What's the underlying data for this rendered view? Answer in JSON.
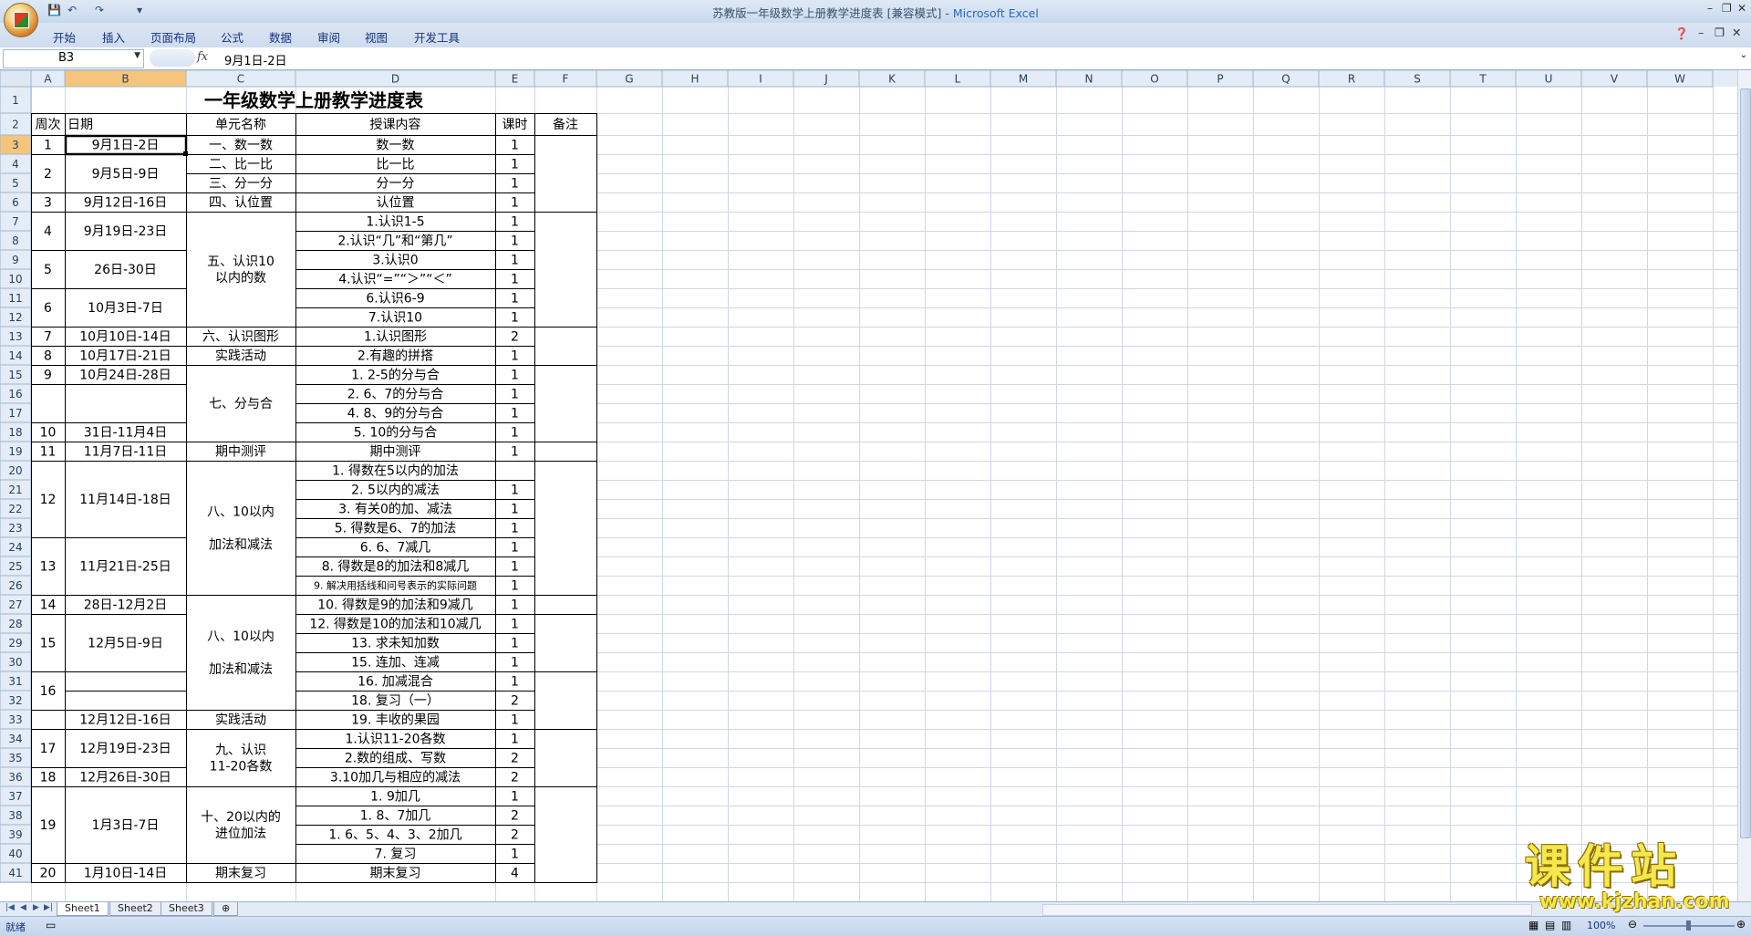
{
  "window": {
    "title_doc": "苏教版一年级数学上册教学进度表  [兼容模式] - ",
    "title_app": "Microsoft Excel"
  },
  "ribbon_tabs": [
    "开始",
    "插入",
    "页面布局",
    "公式",
    "数据",
    "审阅",
    "视图",
    "开发工具"
  ],
  "formula_bar": {
    "name_box": "B3",
    "fx": "fx",
    "value": "9月1日-2日"
  },
  "columns": [
    "A",
    "B",
    "C",
    "D",
    "E",
    "F",
    "G",
    "H",
    "I",
    "J",
    "K",
    "L",
    "M",
    "N",
    "O",
    "P",
    "Q",
    "R",
    "S",
    "T",
    "U",
    "V",
    "W"
  ],
  "selected": {
    "col": "B",
    "row": 3
  },
  "sheet": {
    "title": "一年级数学上册教学进度表",
    "headers": [
      "周次",
      "日期",
      "单元名称",
      "授课内容",
      "课时",
      "备注"
    ],
    "rows": [
      {
        "r": 3,
        "d": "数一数",
        "e": "1"
      },
      {
        "r": 4,
        "d": "比一比",
        "e": "1"
      },
      {
        "r": 5,
        "d": "分一分",
        "e": "1"
      },
      {
        "r": 6,
        "d": "认位置",
        "e": "1"
      },
      {
        "r": 7,
        "d": "1.认识1-5",
        "e": "1"
      },
      {
        "r": 8,
        "d": "2.认识“几”和“第几”",
        "e": "1"
      },
      {
        "r": 9,
        "d": "3.认识0",
        "e": "1"
      },
      {
        "r": 10,
        "d": "4.认识“=”“＞”“＜”",
        "e": "1"
      },
      {
        "r": 11,
        "d": "6.认识6-9",
        "e": "1"
      },
      {
        "r": 12,
        "d": "7.认识10",
        "e": "1"
      },
      {
        "r": 13,
        "d": "1.认识图形",
        "e": "2"
      },
      {
        "r": 14,
        "d": "2.有趣的拼搭",
        "e": "1"
      },
      {
        "r": 15,
        "d": "1. 2-5的分与合",
        "e": "1"
      },
      {
        "r": 16,
        "d": "2. 6、7的分与合",
        "e": "1"
      },
      {
        "r": 17,
        "d": "4. 8、9的分与合",
        "e": "1"
      },
      {
        "r": 18,
        "d": "5. 10的分与合",
        "e": "1"
      },
      {
        "r": 19,
        "d": "期中测评",
        "e": "1"
      },
      {
        "r": 20,
        "d": "1. 得数在5以内的加法",
        "e": ""
      },
      {
        "r": 21,
        "d": "2. 5以内的减法",
        "e": "1"
      },
      {
        "r": 22,
        "d": "3. 有关0的加、减法",
        "e": "1"
      },
      {
        "r": 23,
        "d": "5. 得数是6、7的加法",
        "e": "1"
      },
      {
        "r": 24,
        "d": "6. 6、7减几",
        "e": "1"
      },
      {
        "r": 25,
        "d": "8. 得数是8的加法和8减几",
        "e": "1"
      },
      {
        "r": 26,
        "d": "9. 解决用括线和问号表示的实际问题",
        "e": "1",
        "small": true
      },
      {
        "r": 27,
        "d": "10. 得数是9的加法和9减几",
        "e": "1"
      },
      {
        "r": 28,
        "d": "12. 得数是10的加法和10减几",
        "e": "1"
      },
      {
        "r": 29,
        "d": "13. 求未知加数",
        "e": "1"
      },
      {
        "r": 30,
        "d": "15. 连加、连减",
        "e": "1"
      },
      {
        "r": 31,
        "d": "16. 加减混合",
        "e": "1"
      },
      {
        "r": 32,
        "d": "18. 复习（一）",
        "e": "2"
      },
      {
        "r": 33,
        "d": "19. 丰收的果园",
        "e": "1"
      },
      {
        "r": 34,
        "d": "1.认识11-20各数",
        "e": "1"
      },
      {
        "r": 35,
        "d": "2.数的组成、写数",
        "e": "2"
      },
      {
        "r": 36,
        "d": "3.10加几与相应的减法",
        "e": "2"
      },
      {
        "r": 37,
        "d": "1. 9加几",
        "e": "1"
      },
      {
        "r": 38,
        "d": "1. 8、7加几",
        "e": "2"
      },
      {
        "r": 39,
        "d": "1. 6、5、4、3、2加几",
        "e": "2"
      },
      {
        "r": 40,
        "d": "7. 复习",
        "e": "1"
      },
      {
        "r": 41,
        "d": "期末复习",
        "e": "4"
      }
    ],
    "merges": [
      {
        "c": "A",
        "r1": 3,
        "r2": 3,
        "text": "1"
      },
      {
        "c": "A",
        "r1": 4,
        "r2": 5,
        "text": "2"
      },
      {
        "c": "A",
        "r1": 6,
        "r2": 6,
        "text": "3"
      },
      {
        "c": "A",
        "r1": 7,
        "r2": 8,
        "text": "4"
      },
      {
        "c": "A",
        "r1": 9,
        "r2": 10,
        "text": "5"
      },
      {
        "c": "A",
        "r1": 11,
        "r2": 12,
        "text": "6"
      },
      {
        "c": "A",
        "r1": 13,
        "r2": 13,
        "text": "7"
      },
      {
        "c": "A",
        "r1": 14,
        "r2": 14,
        "text": "8"
      },
      {
        "c": "A",
        "r1": 15,
        "r2": 15,
        "text": "9"
      },
      {
        "c": "A",
        "r1": 16,
        "r2": 17,
        "text": ""
      },
      {
        "c": "A",
        "r1": 18,
        "r2": 18,
        "text": "10"
      },
      {
        "c": "A",
        "r1": 19,
        "r2": 19,
        "text": "11"
      },
      {
        "c": "A",
        "r1": 20,
        "r2": 23,
        "text": "12"
      },
      {
        "c": "A",
        "r1": 24,
        "r2": 26,
        "text": "13"
      },
      {
        "c": "A",
        "r1": 27,
        "r2": 27,
        "text": "14"
      },
      {
        "c": "A",
        "r1": 28,
        "r2": 30,
        "text": "15"
      },
      {
        "c": "A",
        "r1": 31,
        "r2": 32,
        "text": "16"
      },
      {
        "c": "A",
        "r1": 33,
        "r2": 33,
        "text": ""
      },
      {
        "c": "A",
        "r1": 34,
        "r2": 35,
        "text": "17"
      },
      {
        "c": "A",
        "r1": 36,
        "r2": 36,
        "text": "18"
      },
      {
        "c": "A",
        "r1": 37,
        "r2": 40,
        "text": "19"
      },
      {
        "c": "A",
        "r1": 41,
        "r2": 41,
        "text": "20"
      },
      {
        "c": "B",
        "r1": 3,
        "r2": 3,
        "text": "9月1日-2日"
      },
      {
        "c": "B",
        "r1": 4,
        "r2": 5,
        "text": "9月5日-9日"
      },
      {
        "c": "B",
        "r1": 6,
        "r2": 6,
        "text": "9月12日-16日"
      },
      {
        "c": "B",
        "r1": 7,
        "r2": 8,
        "text": "9月19日-23日"
      },
      {
        "c": "B",
        "r1": 9,
        "r2": 10,
        "text": "26日-30日"
      },
      {
        "c": "B",
        "r1": 11,
        "r2": 12,
        "text": "10月3日-7日"
      },
      {
        "c": "B",
        "r1": 13,
        "r2": 13,
        "text": "10月10日-14日"
      },
      {
        "c": "B",
        "r1": 14,
        "r2": 14,
        "text": "10月17日-21日"
      },
      {
        "c": "B",
        "r1": 15,
        "r2": 15,
        "text": "10月24日-28日"
      },
      {
        "c": "B",
        "r1": 16,
        "r2": 17,
        "text": ""
      },
      {
        "c": "B",
        "r1": 18,
        "r2": 18,
        "text": "31日-11月4日"
      },
      {
        "c": "B",
        "r1": 19,
        "r2": 19,
        "text": "11月7日-11日"
      },
      {
        "c": "B",
        "r1": 20,
        "r2": 23,
        "text": "11月14日-18日"
      },
      {
        "c": "B",
        "r1": 24,
        "r2": 26,
        "text": "11月21日-25日"
      },
      {
        "c": "B",
        "r1": 27,
        "r2": 27,
        "text": "28日-12月2日"
      },
      {
        "c": "B",
        "r1": 28,
        "r2": 30,
        "text": "12月5日-9日"
      },
      {
        "c": "B",
        "r1": 31,
        "r2": 31,
        "text": ""
      },
      {
        "c": "B",
        "r1": 32,
        "r2": 32,
        "text": ""
      },
      {
        "c": "B",
        "r1": 33,
        "r2": 33,
        "text": "12月12日-16日"
      },
      {
        "c": "B",
        "r1": 34,
        "r2": 35,
        "text": "12月19日-23日"
      },
      {
        "c": "B",
        "r1": 36,
        "r2": 36,
        "text": "12月26日-30日"
      },
      {
        "c": "B",
        "r1": 37,
        "r2": 40,
        "text": "1月3日-7日"
      },
      {
        "c": "B",
        "r1": 41,
        "r2": 41,
        "text": "1月10日-14日"
      },
      {
        "c": "C",
        "r1": 3,
        "r2": 3,
        "text": "一、数一数"
      },
      {
        "c": "C",
        "r1": 4,
        "r2": 4,
        "text": "二、比一比"
      },
      {
        "c": "C",
        "r1": 5,
        "r2": 5,
        "text": "三、分一分"
      },
      {
        "c": "C",
        "r1": 6,
        "r2": 6,
        "text": "四、认位置"
      },
      {
        "c": "C",
        "r1": 7,
        "r2": 12,
        "text": "五、认识10\n以内的数"
      },
      {
        "c": "C",
        "r1": 13,
        "r2": 13,
        "text": "六、认识图形"
      },
      {
        "c": "C",
        "r1": 14,
        "r2": 14,
        "text": "实践活动"
      },
      {
        "c": "C",
        "r1": 15,
        "r2": 18,
        "text": "七、分与合"
      },
      {
        "c": "C",
        "r1": 19,
        "r2": 19,
        "text": "期中测评"
      },
      {
        "c": "C",
        "r1": 20,
        "r2": 26,
        "text": "八、10以内\n\n加法和减法"
      },
      {
        "c": "C",
        "r1": 27,
        "r2": 32,
        "text": "八、10以内\n\n加法和减法"
      },
      {
        "c": "C",
        "r1": 33,
        "r2": 33,
        "text": "实践活动"
      },
      {
        "c": "C",
        "r1": 34,
        "r2": 36,
        "text": "九、认识\n11-20各数"
      },
      {
        "c": "C",
        "r1": 37,
        "r2": 40,
        "text": "十、20以内的\n进位加法"
      },
      {
        "c": "C",
        "r1": 41,
        "r2": 41,
        "text": "期末复习"
      },
      {
        "c": "F",
        "r1": 3,
        "r2": 6,
        "text": ""
      },
      {
        "c": "F",
        "r1": 7,
        "r2": 12,
        "text": ""
      },
      {
        "c": "F",
        "r1": 13,
        "r2": 14,
        "text": ""
      },
      {
        "c": "F",
        "r1": 15,
        "r2": 18,
        "text": ""
      },
      {
        "c": "F",
        "r1": 19,
        "r2": 19,
        "text": ""
      },
      {
        "c": "F",
        "r1": 20,
        "r2": 26,
        "text": ""
      },
      {
        "c": "F",
        "r1": 27,
        "r2": 27,
        "text": ""
      },
      {
        "c": "F",
        "r1": 28,
        "r2": 30,
        "text": ""
      },
      {
        "c": "F",
        "r1": 31,
        "r2": 33,
        "text": ""
      },
      {
        "c": "F",
        "r1": 34,
        "r2": 36,
        "text": ""
      },
      {
        "c": "F",
        "r1": 37,
        "r2": 41,
        "text": ""
      }
    ]
  },
  "sheet_tabs": [
    "Sheet1",
    "Sheet2",
    "Sheet3"
  ],
  "active_sheet": "Sheet1",
  "status": {
    "mode": "就绪",
    "zoom": "100%"
  },
  "watermark": {
    "main": "课件站",
    "url": "www.kjzhan.com"
  },
  "colors": {
    "header_sel": "#f5c57c",
    "grid": "#d0d7e5",
    "header_bg": "#e4ecf7"
  }
}
